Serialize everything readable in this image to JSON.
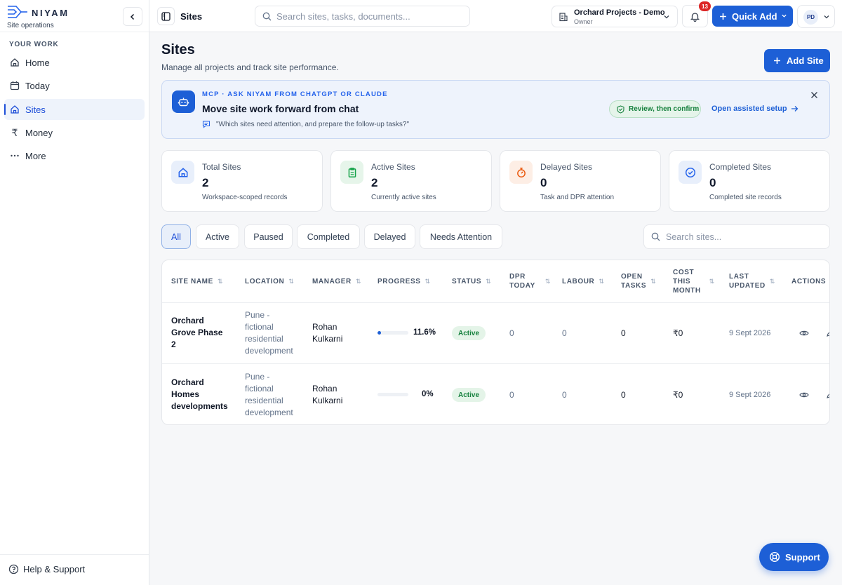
{
  "brand": {
    "name": "NIYAM",
    "tagline": "Site operations"
  },
  "sidebar": {
    "section": "YOUR WORK",
    "items": [
      {
        "label": "Home",
        "icon": "home-icon"
      },
      {
        "label": "Today",
        "icon": "calendar-icon"
      },
      {
        "label": "Sites",
        "icon": "sites-icon",
        "active": true
      },
      {
        "label": "Money",
        "icon": "rupee-icon"
      },
      {
        "label": "More",
        "icon": "more-icon"
      }
    ],
    "help": "Help & Support"
  },
  "topbar": {
    "breadcrumb": "Sites",
    "search_placeholder": "Search sites, tasks, documents...",
    "org_name": "Orchard Projects - Demo",
    "org_role": "Owner",
    "notifications": "13",
    "quick_add": "Quick Add",
    "user_initials": "PD"
  },
  "page": {
    "title": "Sites",
    "subtitle": "Manage all projects and track site performance.",
    "add_button": "Add Site"
  },
  "mcp": {
    "eyebrow": "MCP · ASK NIYAM FROM CHATGPT OR CLAUDE",
    "headline": "Move site work forward from chat",
    "quote": "\"Which sites need attention, and prepare the follow-up tasks?\"",
    "review_badge": "Review, then confirm",
    "setup_link": "Open assisted setup"
  },
  "stats": [
    {
      "label": "Total Sites",
      "value": "2",
      "note": "Workspace-scoped records",
      "color": "#2563eb"
    },
    {
      "label": "Active Sites",
      "value": "2",
      "note": "Currently active sites",
      "color": "#16a34a"
    },
    {
      "label": "Delayed Sites",
      "value": "0",
      "note": "Task and DPR attention",
      "color": "#ea580c"
    },
    {
      "label": "Completed Sites",
      "value": "0",
      "note": "Completed site records",
      "color": "#2563eb"
    }
  ],
  "filters": [
    "All",
    "Active",
    "Paused",
    "Completed",
    "Delayed",
    "Needs Attention"
  ],
  "site_search_placeholder": "Search sites...",
  "table": {
    "headers": {
      "site_name": "SITE NAME",
      "location": "LOCATION",
      "manager": "MANAGER",
      "progress": "PROGRESS",
      "status": "STATUS",
      "dpr_l1": "DPR",
      "dpr_l2": "TODAY",
      "labour": "LABOUR",
      "open_l1": "OPEN",
      "open_l2": "TASKS",
      "cost_l1": "COST",
      "cost_l2": "THIS",
      "cost_l3": "MONTH",
      "upd_l1": "LAST",
      "upd_l2": "UPDATED",
      "actions": "ACTIONS"
    },
    "rows": [
      {
        "name_lines": [
          "Orchard",
          "Grove Phase",
          "2"
        ],
        "location_lines": [
          "Pune -",
          "fictional",
          "residential",
          "development"
        ],
        "manager_lines": [
          "Rohan",
          "Kulkarni"
        ],
        "progress": 0.116,
        "progress_label": "11.6%",
        "status": "Active",
        "dpr_today": "0",
        "labour": "0",
        "open_tasks": "0",
        "cost": "₹0",
        "updated": "9 Sept 2026"
      },
      {
        "name_lines": [
          "Orchard",
          "Homes",
          "developments"
        ],
        "location_lines": [
          "Pune -",
          "fictional",
          "residential",
          "development"
        ],
        "manager_lines": [
          "Rohan",
          "Kulkarni"
        ],
        "progress": 0,
        "progress_label": "0%",
        "status": "Active",
        "dpr_today": "0",
        "labour": "0",
        "open_tasks": "0",
        "cost": "₹0",
        "updated": "9 Sept 2026"
      }
    ]
  },
  "support_button": "Support"
}
